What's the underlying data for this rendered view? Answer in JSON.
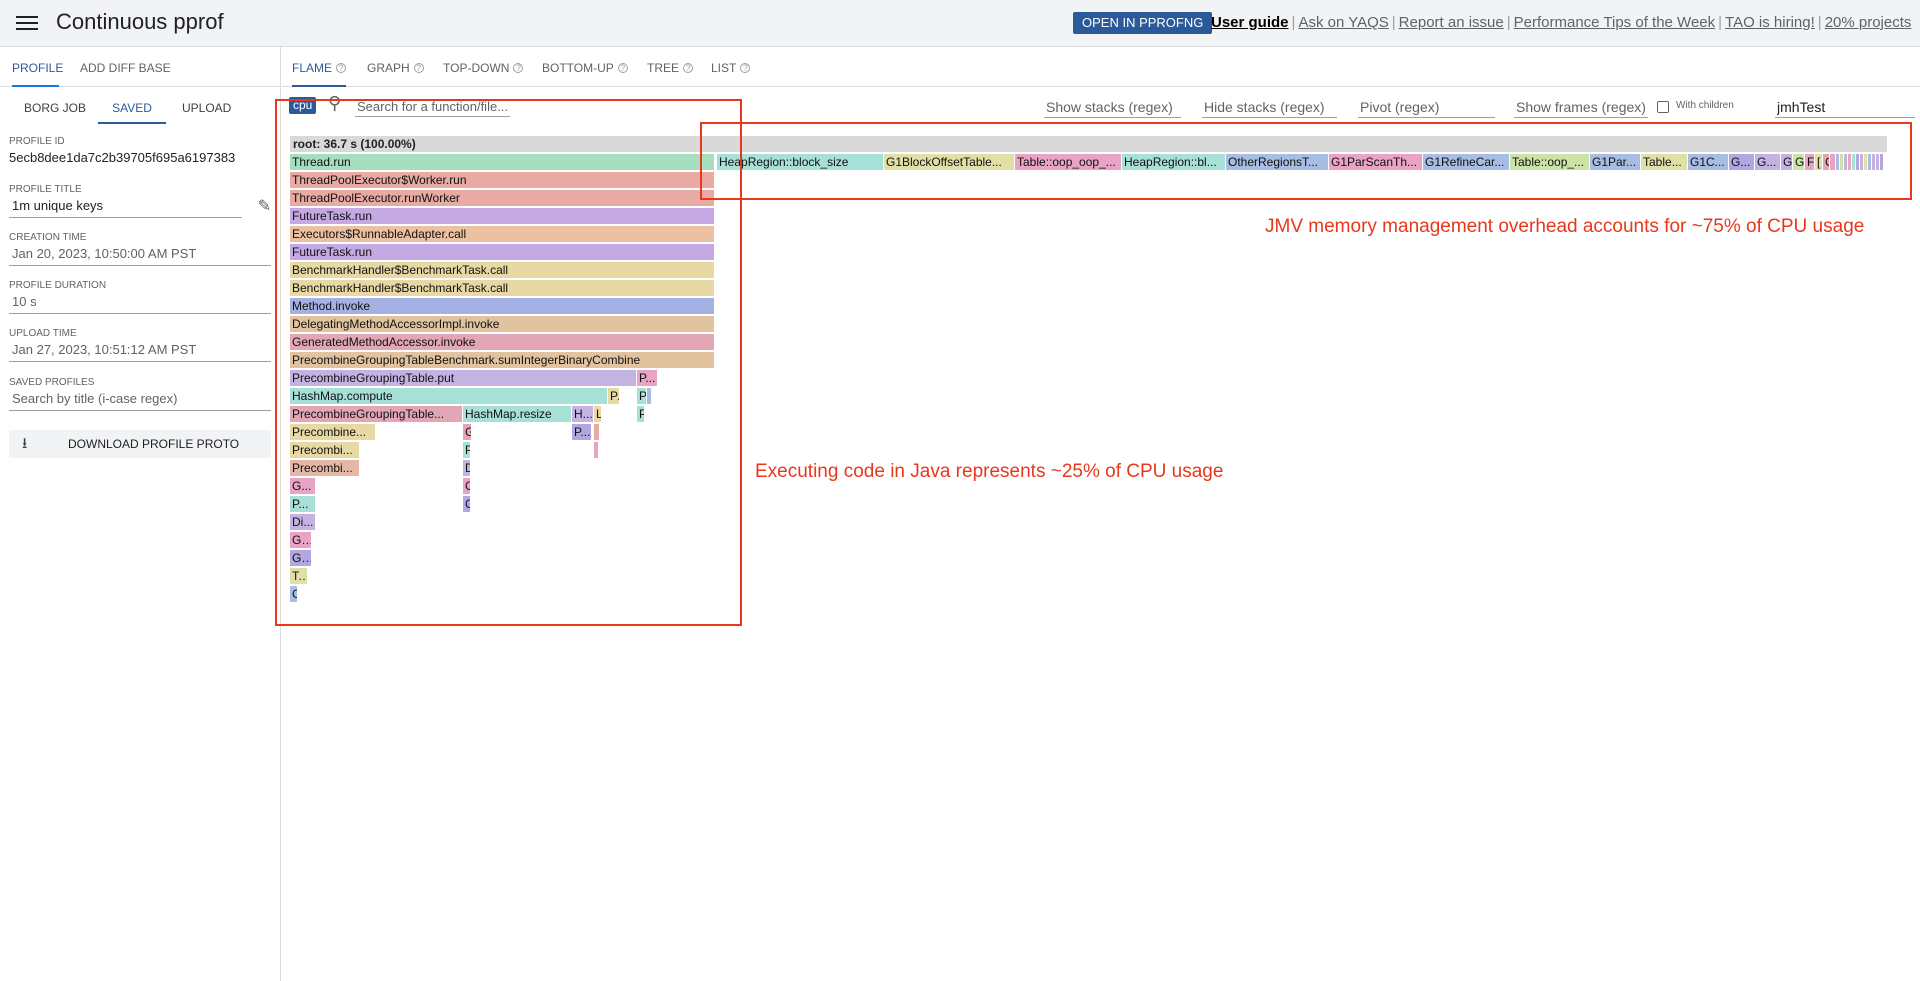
{
  "header": {
    "title": "Continuous pprof",
    "open_button": "OPEN IN PPROFNG",
    "links": [
      "User guide",
      "Ask on YAQS",
      "Report an issue",
      "Performance Tips of the Week",
      "TAO is hiring!",
      "20% projects"
    ]
  },
  "left": {
    "tabs": [
      "PROFILE",
      "ADD DIFF BASE"
    ],
    "subtabs": [
      "BORG JOB",
      "SAVED",
      "UPLOAD"
    ],
    "fields": {
      "profile_id_label": "PROFILE ID",
      "profile_id": "5ecb8dee1da7c2b39705f695a6197383",
      "profile_title_label": "PROFILE TITLE",
      "profile_title": "1m unique keys",
      "creation_time_label": "CREATION TIME",
      "creation_time": "Jan 20, 2023, 10:50:00 AM PST",
      "duration_label": "PROFILE DURATION",
      "duration": "10 s",
      "upload_time_label": "UPLOAD TIME",
      "upload_time": "Jan 27, 2023, 10:51:12 AM PST",
      "saved_profiles_label": "SAVED PROFILES",
      "saved_profiles_placeholder": "Search by title (i-case regex)"
    },
    "download_button": "DOWNLOAD PROFILE PROTO"
  },
  "view_tabs": [
    "FLAME",
    "GRAPH",
    "TOP-DOWN",
    "BOTTOM-UP",
    "TREE",
    "LIST"
  ],
  "toolbar": {
    "sample_type": "cpu",
    "search_placeholder": "Search for a function/file...",
    "show_stacks_placeholder": "Show stacks (regex)",
    "hide_stacks_placeholder": "Hide stacks (regex)",
    "pivot_placeholder": "Pivot (regex)",
    "show_frames_placeholder": "Show frames (regex)",
    "with_children": "With children",
    "profile_name": "jmhTest"
  },
  "flame": {
    "root_label": "root: 36.7 s (100.00%)",
    "colors": {
      "green": "#a8dec0",
      "salmon": "#e8aaa3",
      "purple": "#c5a9e3",
      "orange": "#ecc0a0",
      "khaki": "#e8d8a3",
      "blue": "#a6b1e3",
      "tan": "#e1c39f",
      "pink": "#e9a3c4",
      "teal": "#a6e0d7",
      "lime": "#cce3a6",
      "peach": "#e5b7a6",
      "olive": "#e0e0a6",
      "lavender": "#c4b2e3",
      "steel": "#a7bde3",
      "rose": "#e3a6b5",
      "violet": "#b2a6e3"
    },
    "labels": [
      "Thread.run",
      "ThreadPoolExecutor$Worker.run",
      "ThreadPoolExecutor.runWorker",
      "FutureTask.run",
      "Executors$RunnableAdapter.call",
      "FutureTask.run",
      "BenchmarkHandler$BenchmarkTask.call",
      "BenchmarkHandler$BenchmarkTask.call",
      "Method.invoke",
      "DelegatingMethodAccessorImpl.invoke",
      "GeneratedMethodAccessor.invoke",
      "PrecombineGroupingTableBenchmark.sumIntegerBinaryCombine",
      "PrecombineGroupingTable.put",
      "P...",
      "HashMap.compute",
      "P...",
      "P",
      "I",
      "PrecombineGroupingTable...",
      "HashMap.resize",
      "H...",
      "L",
      "P",
      "Precombine...",
      "G",
      "P...",
      "L",
      "Precombi...",
      "P",
      "F",
      "Precombi...",
      "D",
      "G...",
      "G",
      "P...",
      "G",
      "Di...",
      "G...",
      "G...",
      "T...",
      "C",
      "HeapRegion::block_size",
      "G1BlockOffsetTable...",
      "Table::oop_oop_...",
      "HeapRegion::bl...",
      "OtherRegionsT...",
      "G1ParScanTh...",
      "G1RefineCar...",
      "Table::oop_...",
      "G1Par...",
      "Table...",
      "G1C...",
      "G...",
      "G...",
      "G",
      "G",
      "F",
      "[",
      "C",
      "C"
    ]
  },
  "annotations": {
    "jvm": "JMV memory management overhead accounts for ~75% of CPU usage",
    "java": "Executing code in Java represents ~25% of CPU usage"
  }
}
